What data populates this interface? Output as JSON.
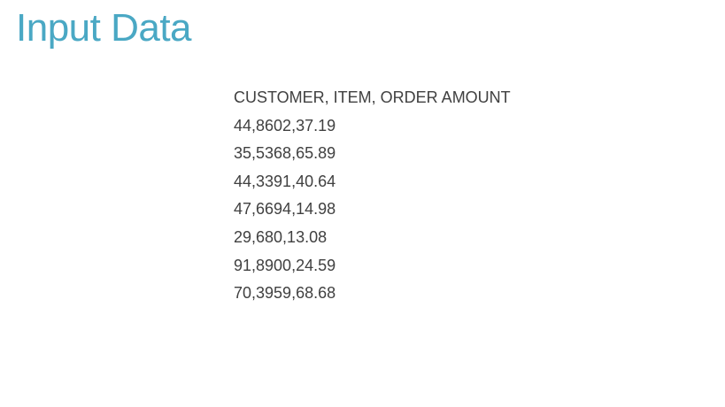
{
  "slide": {
    "title": "Input Data",
    "header_line": "CUSTOMER, ITEM, ORDER AMOUNT",
    "rows": [
      "44,8602,37.19",
      "35,5368,65.89",
      "44,3391,40.64",
      "47,6694,14.98",
      "29,680,13.08",
      "91,8900,24.59",
      "70,3959,68.68"
    ]
  },
  "colors": {
    "title": "#4aa8c4",
    "text": "#404040",
    "background": "#ffffff"
  }
}
